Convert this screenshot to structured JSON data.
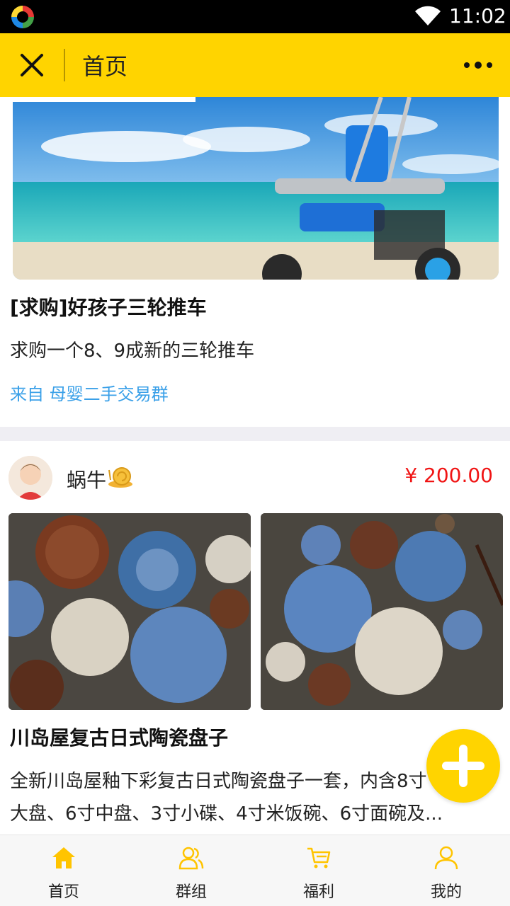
{
  "status_bar": {
    "time": "11:02"
  },
  "title_bar": {
    "title": "首页"
  },
  "post": {
    "title": "[求购]好孩子三轮推车",
    "description": "求购一个8、9成新的三轮推车",
    "source": "来自 母婴二手交易群"
  },
  "listing": {
    "username": "蜗牛",
    "price": "¥ 200.00",
    "title": "川岛屋复古日式陶瓷盘子",
    "description_line1": "全新川岛屋釉下彩复古日式陶瓷盘子一套，内含8寸",
    "description_line2": "大盘、6寸中盘、3寸小碟、4寸米饭碗、6寸面碗及..."
  },
  "bottom_nav": {
    "items": [
      {
        "label": "首页",
        "icon": "home-icon",
        "active": true
      },
      {
        "label": "群组",
        "icon": "group-icon",
        "active": false
      },
      {
        "label": "福利",
        "icon": "cart-icon",
        "active": false
      },
      {
        "label": "我的",
        "icon": "user-icon",
        "active": false
      }
    ]
  },
  "colors": {
    "accent": "#ffd400",
    "price": "#f01414",
    "link": "#3aa0e8"
  }
}
